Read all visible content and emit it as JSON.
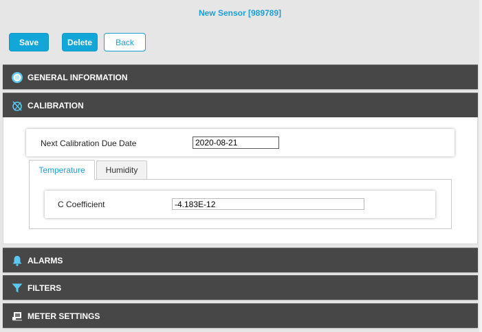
{
  "header": {
    "title": "New Sensor [989789]"
  },
  "toolbar": {
    "save_label": "Save",
    "delete_label": "Delete",
    "back_label": "Back"
  },
  "sections": {
    "general": {
      "label": "GENERAL INFORMATION",
      "icon": "info-circle-icon"
    },
    "calibration": {
      "label": "CALIBRATION",
      "icon": "calibration-icon"
    },
    "alarms": {
      "label": "ALARMS",
      "icon": "bell-icon"
    },
    "filters": {
      "label": "FILTERS",
      "icon": "funnel-icon"
    },
    "meter": {
      "label": "METER SETTINGS",
      "icon": "meter-icon"
    }
  },
  "calibration": {
    "due_date_label": "Next Calibration Due Date",
    "due_date_value": "2020-08-21",
    "tabs": [
      {
        "label": "Temperature",
        "active": true
      },
      {
        "label": "Humidity",
        "active": false
      }
    ],
    "coefficient_label": "C Coefficient",
    "coefficient_value": "-4.183E-12"
  },
  "colors": {
    "accent": "#12a6d9",
    "header_bg": "#474747",
    "page_bg": "#e6e6e6"
  }
}
